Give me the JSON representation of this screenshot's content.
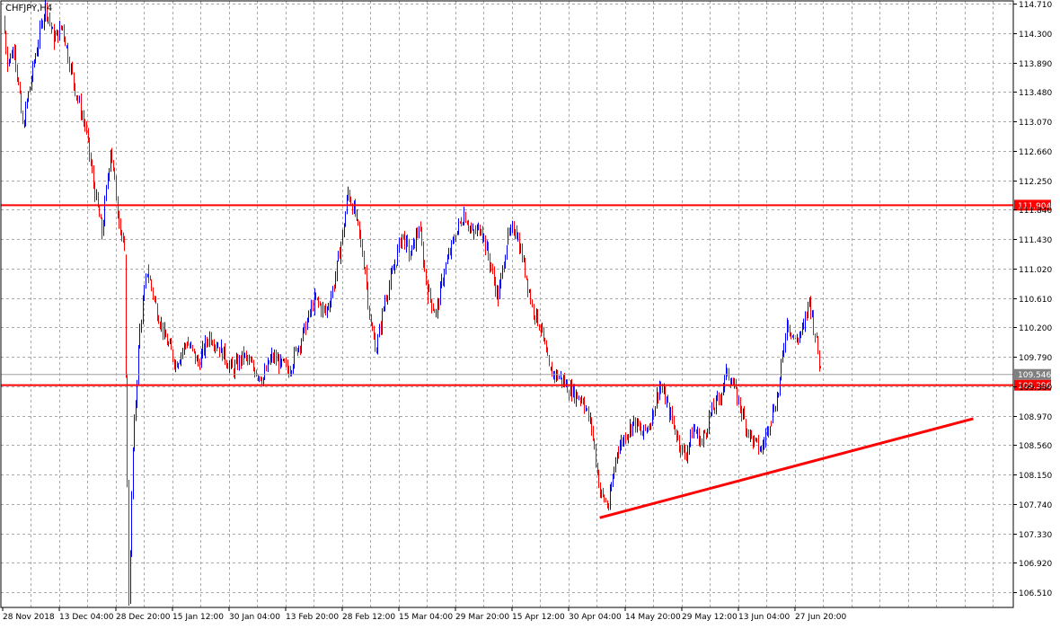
{
  "chart_data": {
    "type": "candlestick",
    "symbol_label": "CHFJPY,H4",
    "ylim": [
      106.3,
      114.75
    ],
    "y_ticks": [
      "114.710",
      "114.300",
      "113.890",
      "113.480",
      "113.070",
      "112.660",
      "112.250",
      "111.840",
      "111.430",
      "111.020",
      "110.610",
      "110.200",
      "109.790",
      "109.380",
      "108.970",
      "108.560",
      "108.150",
      "107.740",
      "107.330",
      "106.920",
      "106.510"
    ],
    "x_ticks": [
      "28 Nov 2018",
      "13 Dec 04:00",
      "28 Dec 20:00",
      "15 Jan 12:00",
      "30 Jan 04:00",
      "13 Feb 20:00",
      "28 Feb 12:00",
      "15 Mar 04:00",
      "29 Mar 20:00",
      "15 Apr 12:00",
      "30 Apr 04:00",
      "14 May 20:00",
      "29 May 12:00",
      "13 Jun 04:00",
      "27 Jun 20:00"
    ],
    "horizontal_lines": [
      {
        "price": 111.904,
        "label": "111.904"
      },
      {
        "price": 109.396,
        "label": "109.396"
      }
    ],
    "current_price": {
      "price": 109.546,
      "label": "109.546"
    },
    "trendline": {
      "start": {
        "x_index": 10.55,
        "price": 107.55
      },
      "end": {
        "x_index": 17.15,
        "price": 108.93
      }
    },
    "price_path": [
      [
        0,
        114.5
      ],
      [
        0.08,
        113.9
      ],
      [
        0.2,
        114.1
      ],
      [
        0.35,
        113.0
      ],
      [
        0.55,
        113.9
      ],
      [
        0.75,
        114.7
      ],
      [
        0.9,
        114.2
      ],
      [
        1.05,
        114.4
      ],
      [
        1.25,
        113.6
      ],
      [
        1.45,
        113.0
      ],
      [
        1.6,
        112.2
      ],
      [
        1.75,
        111.5
      ],
      [
        1.9,
        112.7
      ],
      [
        2.05,
        111.7
      ],
      [
        2.15,
        111.2
      ],
      [
        2.22,
        106.4
      ],
      [
        2.3,
        108.5
      ],
      [
        2.42,
        110.2
      ],
      [
        2.55,
        111.0
      ],
      [
        2.7,
        110.5
      ],
      [
        2.85,
        110.1
      ],
      [
        3.05,
        109.7
      ],
      [
        3.25,
        110.0
      ],
      [
        3.45,
        109.7
      ],
      [
        3.65,
        110.1
      ],
      [
        3.85,
        109.9
      ],
      [
        4.05,
        109.6
      ],
      [
        4.25,
        109.8
      ],
      [
        4.45,
        109.6
      ],
      [
        4.6,
        109.5
      ],
      [
        4.75,
        109.8
      ],
      [
        4.9,
        109.7
      ],
      [
        5.05,
        109.6
      ],
      [
        5.2,
        109.9
      ],
      [
        5.35,
        110.2
      ],
      [
        5.5,
        110.6
      ],
      [
        5.7,
        110.4
      ],
      [
        5.85,
        110.8
      ],
      [
        6.0,
        111.5
      ],
      [
        6.1,
        112.1
      ],
      [
        6.25,
        111.7
      ],
      [
        6.4,
        111.0
      ],
      [
        6.5,
        110.2
      ],
      [
        6.6,
        109.9
      ],
      [
        6.75,
        110.6
      ],
      [
        6.9,
        111.0
      ],
      [
        7.05,
        111.5
      ],
      [
        7.2,
        111.2
      ],
      [
        7.35,
        111.6
      ],
      [
        7.5,
        110.7
      ],
      [
        7.65,
        110.4
      ],
      [
        7.8,
        111.0
      ],
      [
        8.0,
        111.5
      ],
      [
        8.15,
        111.8
      ],
      [
        8.3,
        111.5
      ],
      [
        8.45,
        111.6
      ],
      [
        8.6,
        111.1
      ],
      [
        8.75,
        110.6
      ],
      [
        8.9,
        111.4
      ],
      [
        9.05,
        111.6
      ],
      [
        9.2,
        111.1
      ],
      [
        9.35,
        110.5
      ],
      [
        9.5,
        110.2
      ],
      [
        9.65,
        109.6
      ],
      [
        9.85,
        109.5
      ],
      [
        10.05,
        109.3
      ],
      [
        10.25,
        109.2
      ],
      [
        10.4,
        108.8
      ],
      [
        10.55,
        107.9
      ],
      [
        10.7,
        107.7
      ],
      [
        10.85,
        108.5
      ],
      [
        11.0,
        108.7
      ],
      [
        11.15,
        108.9
      ],
      [
        11.3,
        108.7
      ],
      [
        11.45,
        108.9
      ],
      [
        11.6,
        109.4
      ],
      [
        11.75,
        109.1
      ],
      [
        11.9,
        108.7
      ],
      [
        12.05,
        108.4
      ],
      [
        12.2,
        108.8
      ],
      [
        12.35,
        108.6
      ],
      [
        12.5,
        109.0
      ],
      [
        12.65,
        109.2
      ],
      [
        12.8,
        109.6
      ],
      [
        12.95,
        109.3
      ],
      [
        13.1,
        108.9
      ],
      [
        13.25,
        108.6
      ],
      [
        13.4,
        108.5
      ],
      [
        13.55,
        108.9
      ],
      [
        13.7,
        109.3
      ],
      [
        13.85,
        110.3
      ],
      [
        14.0,
        110.0
      ],
      [
        14.15,
        110.2
      ],
      [
        14.25,
        110.6
      ],
      [
        14.35,
        110.1
      ],
      [
        14.45,
        109.6
      ]
    ]
  }
}
